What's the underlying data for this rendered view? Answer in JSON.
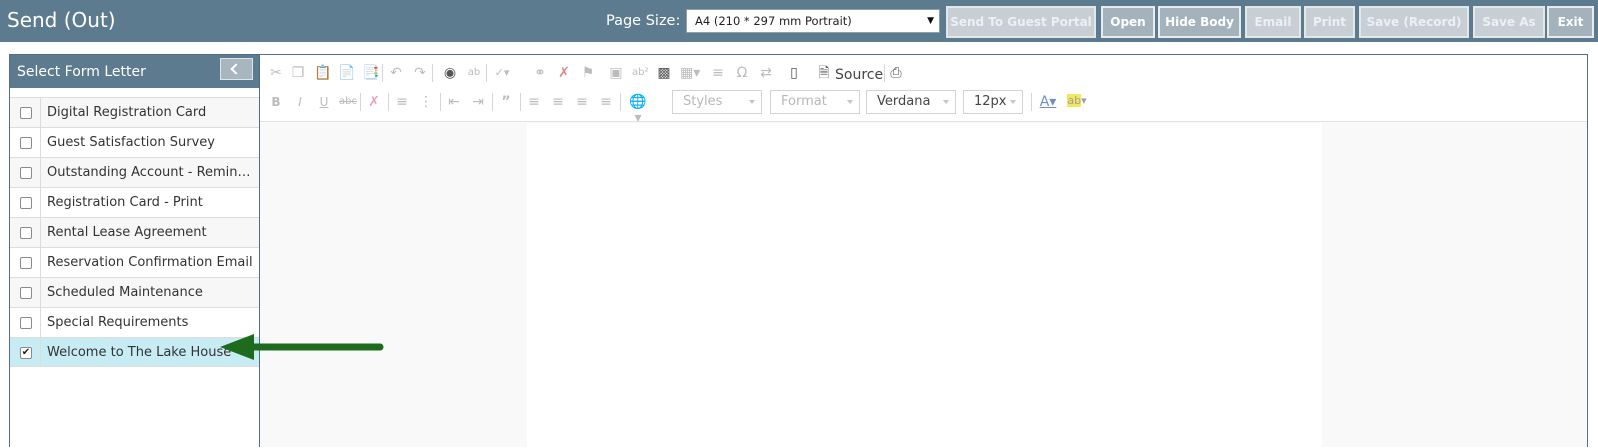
{
  "header": {
    "title": "Send (Out)",
    "page_size_label": "Page Size:",
    "page_size_value": "A4 (210 * 297 mm Portrait)",
    "buttons": [
      {
        "label": "Send To Guest Portal",
        "enabled": false
      },
      {
        "label": "Open",
        "enabled": true
      },
      {
        "label": "Hide Body",
        "enabled": true
      },
      {
        "label": "Email",
        "enabled": false
      },
      {
        "label": "Print",
        "enabled": false
      },
      {
        "label": "Save (Record)",
        "enabled": false
      },
      {
        "label": "Save As",
        "enabled": false
      },
      {
        "label": "Exit",
        "enabled": true
      }
    ]
  },
  "sidebar": {
    "title": "Select Form Letter",
    "items": [
      {
        "label": "Digital Registration Card",
        "checked": false
      },
      {
        "label": "Guest Satisfaction Survey",
        "checked": false
      },
      {
        "label": "Outstanding Account - Reminder Letter",
        "checked": false
      },
      {
        "label": "Registration Card - Print",
        "checked": false
      },
      {
        "label": "Rental Lease Agreement",
        "checked": false
      },
      {
        "label": "Reservation Confirmation Email",
        "checked": false
      },
      {
        "label": "Scheduled Maintenance",
        "checked": false
      },
      {
        "label": "Special Requirements",
        "checked": false
      },
      {
        "label": "Welcome to The Lake House",
        "checked": true
      }
    ]
  },
  "editor": {
    "source_label": "Source",
    "styles_label": "Styles",
    "format_label": "Format",
    "font_value": "Verdana",
    "size_value": "12px"
  },
  "colors": {
    "header_bg": "#5d7b8e",
    "selected_row": "#c8ecf3",
    "arrow": "#1e6b1e"
  }
}
